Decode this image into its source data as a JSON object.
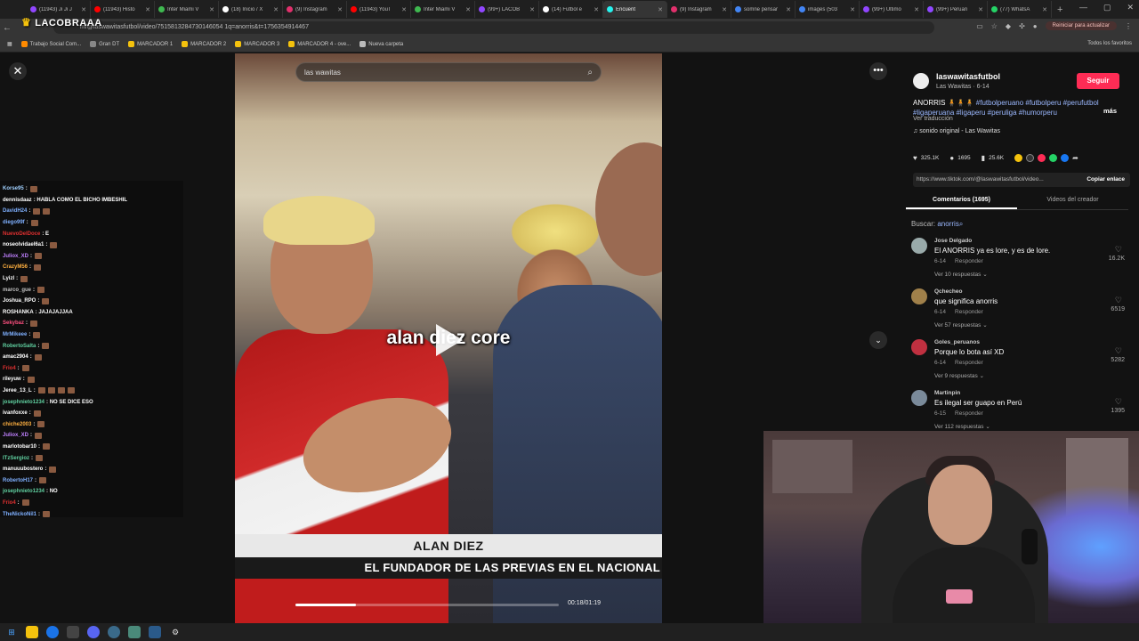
{
  "browser": {
    "tabs": [
      {
        "label": "(11943) Ji Ji J",
        "color": "#9146ff",
        "active": false
      },
      {
        "label": "(11943) Histo",
        "color": "#ff0000",
        "active": false
      },
      {
        "label": "Inter Miami V",
        "color": "#3fb950",
        "active": false
      },
      {
        "label": "(18) Inicio / X",
        "color": "#ffffff",
        "active": false
      },
      {
        "label": "(9) Instagram",
        "color": "#e1306c",
        "active": false
      },
      {
        "label": "(11943) YouT",
        "color": "#ff0000",
        "active": false
      },
      {
        "label": "Inter Miami V",
        "color": "#3fb950",
        "active": false
      },
      {
        "label": "(99+) LACOB",
        "color": "#9146ff",
        "active": false
      },
      {
        "label": "(14) Futbol e",
        "color": "#ffffff",
        "active": false
      },
      {
        "label": "Encuent",
        "color": "#25f4ee",
        "active": true
      },
      {
        "label": "(9) Instagram",
        "color": "#e1306c",
        "active": false
      },
      {
        "label": "somne pensar",
        "color": "#4285f4",
        "active": false
      },
      {
        "label": "images (503",
        "color": "#4285f4",
        "active": false
      },
      {
        "label": "(99+) Último",
        "color": "#9146ff",
        "active": false
      },
      {
        "label": "(99+) Peruan",
        "color": "#9146ff",
        "active": false
      },
      {
        "label": "(77) WhatsA",
        "color": "#25d366",
        "active": false
      }
    ],
    "url": "m/@laswawitasfutbol/video/7515813284730146054 1q=anorris&t=1756354914467",
    "overlay_logo": "LACOBRAAA",
    "reload_label": "Reiniciar para actualizar",
    "bookmarks": [
      {
        "label": "Trabajo Social Com...",
        "color": "#ff8a00"
      },
      {
        "label": "Gran DT",
        "color": "#888888"
      },
      {
        "label": "MARCADOR 1",
        "color": "#f4c20d"
      },
      {
        "label": "MARCADOR 2",
        "color": "#f4c20d"
      },
      {
        "label": "MARCADOR 3",
        "color": "#f4c20d"
      },
      {
        "label": "MARCADOR 4 - ove...",
        "color": "#f4c20d"
      },
      {
        "label": "Nueva carpeta",
        "color": "#bbbbbb"
      }
    ],
    "all_bookmarks": "Todos los favoritos"
  },
  "video": {
    "search_placeholder": "las wawitas",
    "caption": "alan diez core",
    "lower_third_name": "ALAN DIEZ",
    "lower_third_desc": "EL FUNDADOR DE LAS PREVIAS EN EL NACIONAL",
    "time": "00:18/01:19",
    "progress_fraction": 0.23
  },
  "chat": [
    {
      "user": "Korse95",
      "msg": "",
      "color": "#a0d0ff",
      "emotes": 1
    },
    {
      "user": "dennisdaaz",
      "msg": "HABLA COMO EL BICHO IMBESHIL",
      "color": "#ffffff",
      "emotes": 0
    },
    {
      "user": "DavidH24",
      "msg": "",
      "color": "#7fb0ff",
      "emotes": 2
    },
    {
      "user": "diego99f",
      "msg": "",
      "color": "#7fb0ff",
      "emotes": 1
    },
    {
      "user": "NuevoDelDoce",
      "msg": "E",
      "color": "#e03030",
      "emotes": 0
    },
    {
      "user": "noseolvidael6a1",
      "msg": "",
      "color": "#ffffff",
      "emotes": 1
    },
    {
      "user": "Juliox_XD",
      "msg": "",
      "color": "#c080ff",
      "emotes": 1
    },
    {
      "user": "CrazyM56",
      "msg": "",
      "color": "#ffb040",
      "emotes": 1
    },
    {
      "user": "Lyizl",
      "msg": "",
      "color": "#ffffff",
      "emotes": 1
    },
    {
      "user": "marco_gue",
      "msg": "",
      "color": "#c0c0c0",
      "emotes": 1
    },
    {
      "user": "Joshua_RPO",
      "msg": "",
      "color": "#ffffff",
      "emotes": 1
    },
    {
      "user": "ROSHANKA",
      "msg": "JAJAJAJJAA",
      "color": "#ffffff",
      "emotes": 0
    },
    {
      "user": "Sekybaz",
      "msg": "",
      "color": "#ff5080",
      "emotes": 1
    },
    {
      "user": "MrMikeee",
      "msg": "",
      "color": "#7fb0ff",
      "emotes": 1
    },
    {
      "user": "RobertoSalta",
      "msg": "",
      "color": "#60d0a0",
      "emotes": 1
    },
    {
      "user": "amac2904",
      "msg": "",
      "color": "#ffffff",
      "emotes": 1
    },
    {
      "user": "Frio4",
      "msg": "",
      "color": "#e03030",
      "emotes": 1
    },
    {
      "user": "rileyuw",
      "msg": "",
      "color": "#ffffff",
      "emotes": 1
    },
    {
      "user": "Jeree_13_L",
      "msg": "",
      "color": "#ffffff",
      "emotes": 4
    },
    {
      "user": "josephnieto1234",
      "msg": "NO SE DICE ESO",
      "color": "#60d0a0",
      "emotes": 0
    },
    {
      "user": "ivanfoxxe",
      "msg": "",
      "color": "#ffffff",
      "emotes": 1
    },
    {
      "user": "chiche2003",
      "msg": "",
      "color": "#ffb040",
      "emotes": 1
    },
    {
      "user": "Juliox_XD",
      "msg": "",
      "color": "#c080ff",
      "emotes": 1
    },
    {
      "user": "marlotobar10",
      "msg": "",
      "color": "#ffffff",
      "emotes": 1
    },
    {
      "user": "ITzSergioz",
      "msg": "",
      "color": "#60d0a0",
      "emotes": 1
    },
    {
      "user": "manuuubostero",
      "msg": "",
      "color": "#ffffff",
      "emotes": 1
    },
    {
      "user": "RobertoH17",
      "msg": "",
      "color": "#7fb0ff",
      "emotes": 1
    },
    {
      "user": "josephnieto1234",
      "msg": "NO",
      "color": "#60d0a0",
      "emotes": 0
    },
    {
      "user": "Frio4",
      "msg": "",
      "color": "#e03030",
      "emotes": 1
    },
    {
      "user": "TheNickoNil1",
      "msg": "",
      "color": "#7fb0ff",
      "emotes": 1
    }
  ],
  "account": {
    "name": "laswawitasfutbol",
    "sub": "Las Wawitas · 6-14",
    "follow_label": "Seguir",
    "description": "ANORRIS",
    "hashtags": "#futbolperuano #futbolperu #perufutbol #ligaperuana #ligaperu #peruliga #humorperu",
    "more_label": "más",
    "translate_label": "Ver traducción",
    "sound": "sonido original - Las Wawitas"
  },
  "actions": {
    "likes": "325.1K",
    "comments": "1695",
    "saves": "25.6K",
    "link": "https://www.tiktok.com/@laswawitasfutbol/video...",
    "copy_label": "Copiar enlace"
  },
  "comment_tabs": {
    "comments": "Comentarios (1695)",
    "creator": "Videos del creador"
  },
  "comment_search": {
    "label": "Buscar:",
    "term": "anorris"
  },
  "comments": [
    {
      "user": "Jose Delgado",
      "text": "El ANORRIS ya es lore, y es de lore.",
      "date": "6-14",
      "reply": "Responder",
      "replies": "Ver 10 respuestas",
      "likes": "16.2K",
      "avatar": "#9aa"
    },
    {
      "user": "Qchecheo",
      "text": "que significa anorris",
      "date": "6-14",
      "reply": "Responder",
      "replies": "Ver 57 respuestas",
      "likes": "6519",
      "avatar": "#a0804a"
    },
    {
      "user": "Goles_peruanos",
      "text": "Porque lo bota así XD",
      "date": "6-14",
      "reply": "Responder",
      "replies": "Ver 9 respuestas",
      "likes": "5282",
      "avatar": "#c03040"
    },
    {
      "user": "Martinpin",
      "text": "Es ilegal ser guapo en Perú",
      "date": "6-15",
      "reply": "Responder",
      "replies": "Ver 112 respuestas",
      "likes": "1395",
      "avatar": "#7a8a9a"
    }
  ]
}
